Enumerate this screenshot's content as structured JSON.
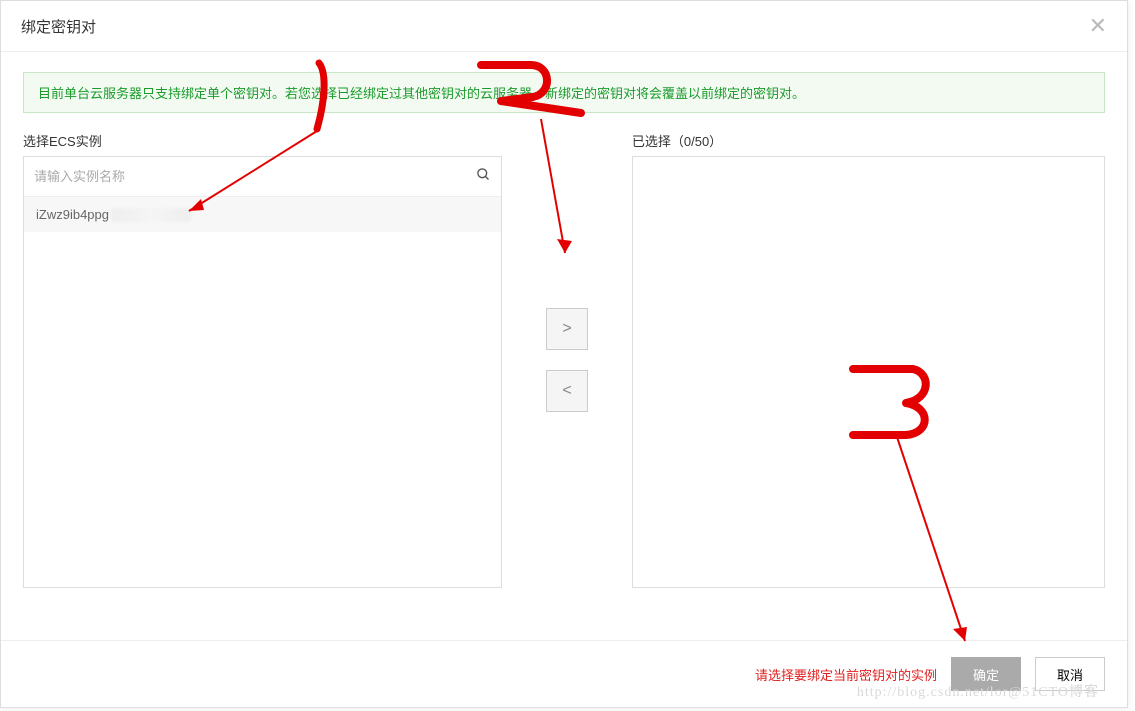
{
  "dialog": {
    "title": "绑定密钥对",
    "info_banner": "目前单台云服务器只支持绑定单个密钥对。若您选择已经绑定过其他密钥对的云服务器，新绑定的密钥对将会覆盖以前绑定的密钥对。"
  },
  "left": {
    "label": "选择ECS实例",
    "search_placeholder": "请输入实例名称",
    "instances": [
      {
        "name": "iZwz9ib4ppg"
      }
    ]
  },
  "transfer": {
    "move_right_label": ">",
    "move_left_label": "<"
  },
  "right": {
    "label": "已选择（0/50）"
  },
  "footer": {
    "error": "请选择要绑定当前密钥对的实例",
    "confirm": "确定",
    "cancel": "取消"
  },
  "watermark": "http://blog.csdn.net/lor@51CTO博客"
}
